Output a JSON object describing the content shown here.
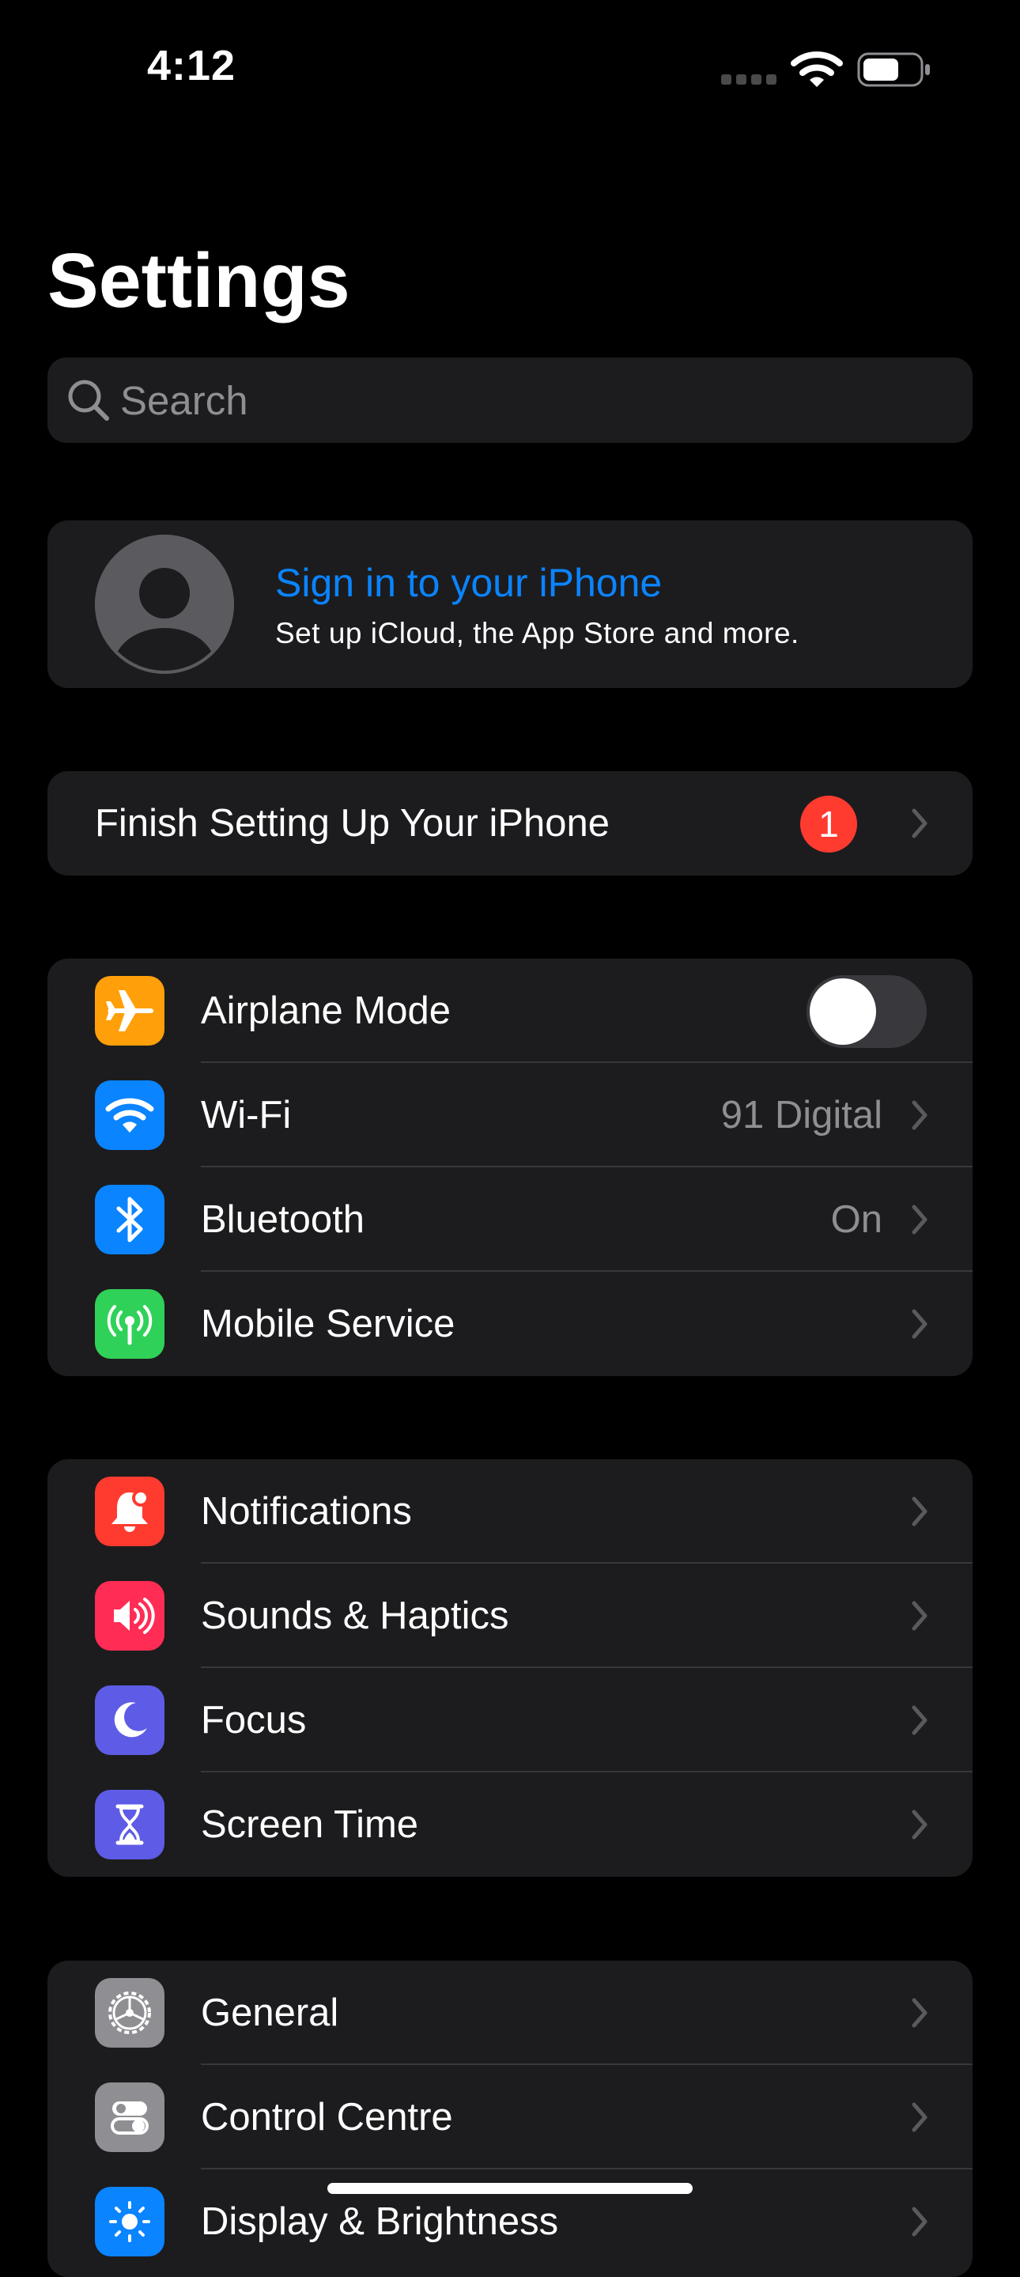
{
  "status_bar": {
    "time": "4:12"
  },
  "header": {
    "title": "Settings"
  },
  "search": {
    "placeholder": "Search"
  },
  "profile": {
    "title": "Sign in to your iPhone",
    "subtitle": "Set up iCloud, the App Store and more."
  },
  "setup": {
    "label": "Finish Setting Up Your iPhone",
    "badge": "1"
  },
  "connectivity": [
    {
      "label": "Airplane Mode",
      "icon": "airplane-icon",
      "color": "#ff9f0a",
      "toggle": false
    },
    {
      "label": "Wi-Fi",
      "icon": "wifi-icon",
      "color": "#0a84ff",
      "value": "91 Digital"
    },
    {
      "label": "Bluetooth",
      "icon": "bluetooth-icon",
      "color": "#0a84ff",
      "value": "On"
    },
    {
      "label": "Mobile Service",
      "icon": "antenna-icon",
      "color": "#30d158",
      "value": ""
    }
  ],
  "alerts": [
    {
      "label": "Notifications",
      "icon": "bell-icon",
      "color": "#ff3b30"
    },
    {
      "label": "Sounds & Haptics",
      "icon": "speaker-icon",
      "color": "#ff2d55"
    },
    {
      "label": "Focus",
      "icon": "moon-icon",
      "color": "#5e5ce6"
    },
    {
      "label": "Screen Time",
      "icon": "hourglass-icon",
      "color": "#5e5ce6"
    }
  ],
  "general": [
    {
      "label": "General",
      "icon": "gear-icon",
      "color": "#8e8e93"
    },
    {
      "label": "Control Centre",
      "icon": "switches-icon",
      "color": "#8e8e93"
    },
    {
      "label": "Display & Brightness",
      "icon": "sun-icon",
      "color": "#0a84ff"
    }
  ]
}
